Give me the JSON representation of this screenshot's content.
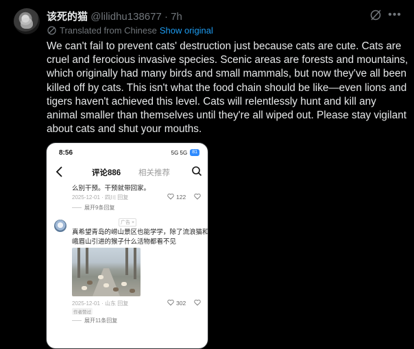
{
  "tweet": {
    "display_name": "该死的猫",
    "handle": "@lilidhu138677",
    "separator": "·",
    "time": "7h",
    "translated_label": "Translated from Chinese",
    "show_original": "Show original",
    "body": "We can't fail to prevent cats' destruction just because cats are cute. Cats are cruel and ferocious invasive species. Scenic areas are forests and mountains, which originally had many birds and small mammals, but now they've all been killed off by cats. This isn't what the food chain should be like—even lions and tigers haven't achieved this level. Cats will relentlessly hunt and kill any animal smaller than themselves until they're all wiped out. Please stay vigilant about cats and shut your mouths.",
    "icons": {
      "grok": "grok-icon",
      "more": "more-icon",
      "translate": "translate-icon"
    }
  },
  "phone": {
    "status_time": "8:56",
    "status_icons": "5G 5G",
    "battery": "81",
    "tabs": {
      "comments": "评论886",
      "related": "相关推荐"
    },
    "comments": [
      {
        "text": "么别干预。干预就带回家。",
        "meta": "2025-12-01 · 四川   回复",
        "likes": "122",
        "expand": "展开9条回复"
      },
      {
        "ad_badge": "广告 ×",
        "text_line1": "真希望青岛的崂山景区也能学学，除了流浪猫和",
        "text_line2": "峨眉山引进的猴子什么活物都看不见",
        "meta": "2025-12-01 · 山东   回复",
        "likes": "302",
        "author_tag": "作者赞过",
        "expand": "展开11条回复"
      }
    ]
  }
}
